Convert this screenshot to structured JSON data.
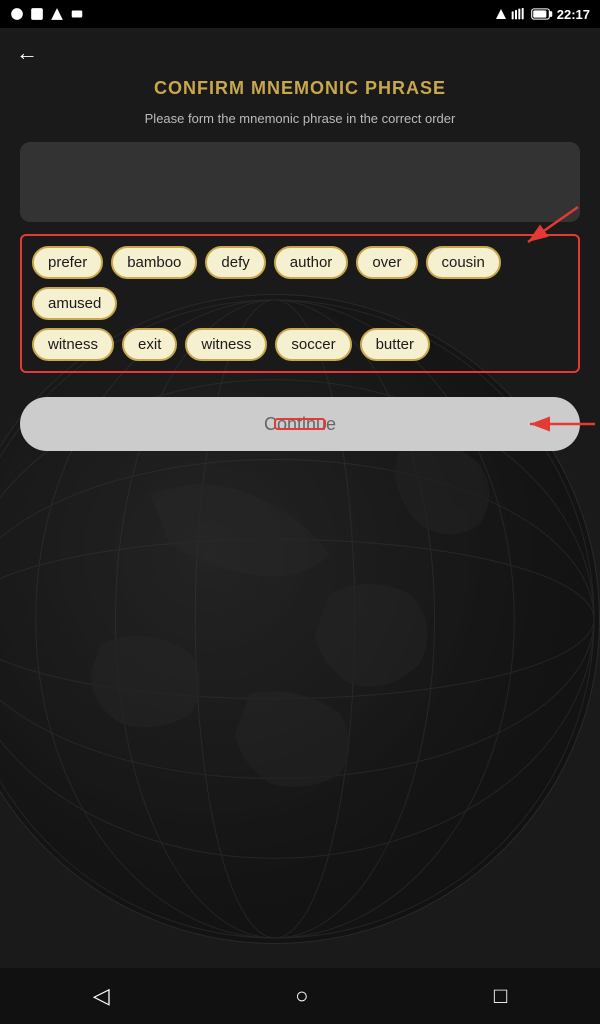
{
  "statusBar": {
    "time": "22:17",
    "batteryIcon": "🔋",
    "wifiIcon": "▾"
  },
  "nav": {
    "backLabel": "←"
  },
  "page": {
    "title": "CONFIRM MNEMONIC PHRASE",
    "subtitle": "Please form the mnemonic phrase in the correct order"
  },
  "wordGrid": {
    "row1": [
      "prefer",
      "bamboo",
      "defy",
      "author",
      "over",
      "cousin",
      "amused"
    ],
    "row2": [
      "witness",
      "exit",
      "witness",
      "soccer",
      "butter"
    ]
  },
  "continueButton": {
    "label": "Continue"
  },
  "bottomNav": {
    "back": "◁",
    "home": "○",
    "recent": "□"
  }
}
